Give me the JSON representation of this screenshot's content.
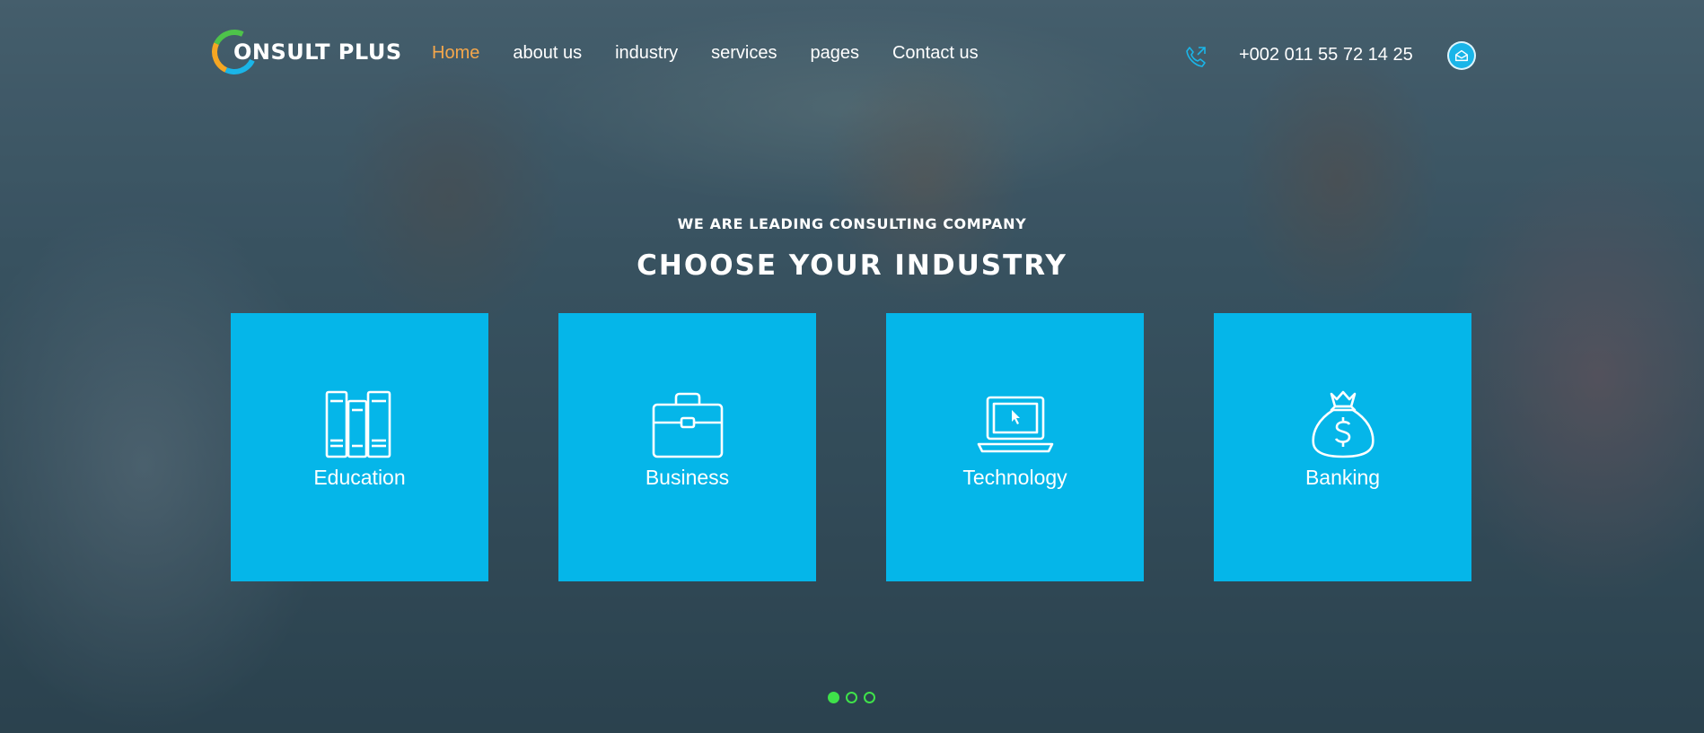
{
  "brand": {
    "logo_text": "ONSULT PLUS",
    "ring_colors": [
      "#4ec34a",
      "#f5a623",
      "#1ab5e8"
    ]
  },
  "nav": {
    "items": [
      {
        "label": "Home",
        "active": true
      },
      {
        "label": "about us",
        "active": false
      },
      {
        "label": "industry",
        "active": false
      },
      {
        "label": "services",
        "active": false
      },
      {
        "label": "pages",
        "active": false
      },
      {
        "label": "Contact us",
        "active": false
      }
    ],
    "active_color": "#f5a74b"
  },
  "contact": {
    "phone_icon": "phone-icon",
    "phone": "+002 011 55 72 14 25",
    "mail_icon": "mail-icon"
  },
  "hero": {
    "subtitle": "WE ARE LEADING CONSULTING COMPANY",
    "title": "CHOOSE YOUR INDUSTRY"
  },
  "cards": [
    {
      "label": "Education",
      "icon": "books-icon"
    },
    {
      "label": "Business",
      "icon": "briefcase-icon"
    },
    {
      "label": "Technology",
      "icon": "laptop-icon"
    },
    {
      "label": "Banking",
      "icon": "money-bag-icon"
    }
  ],
  "slider": {
    "dot_count": 3,
    "active_index": 0
  },
  "colors": {
    "card_bg": "#05b6e9",
    "accent": "#1ab5e8",
    "dot": "#3fe24a"
  }
}
